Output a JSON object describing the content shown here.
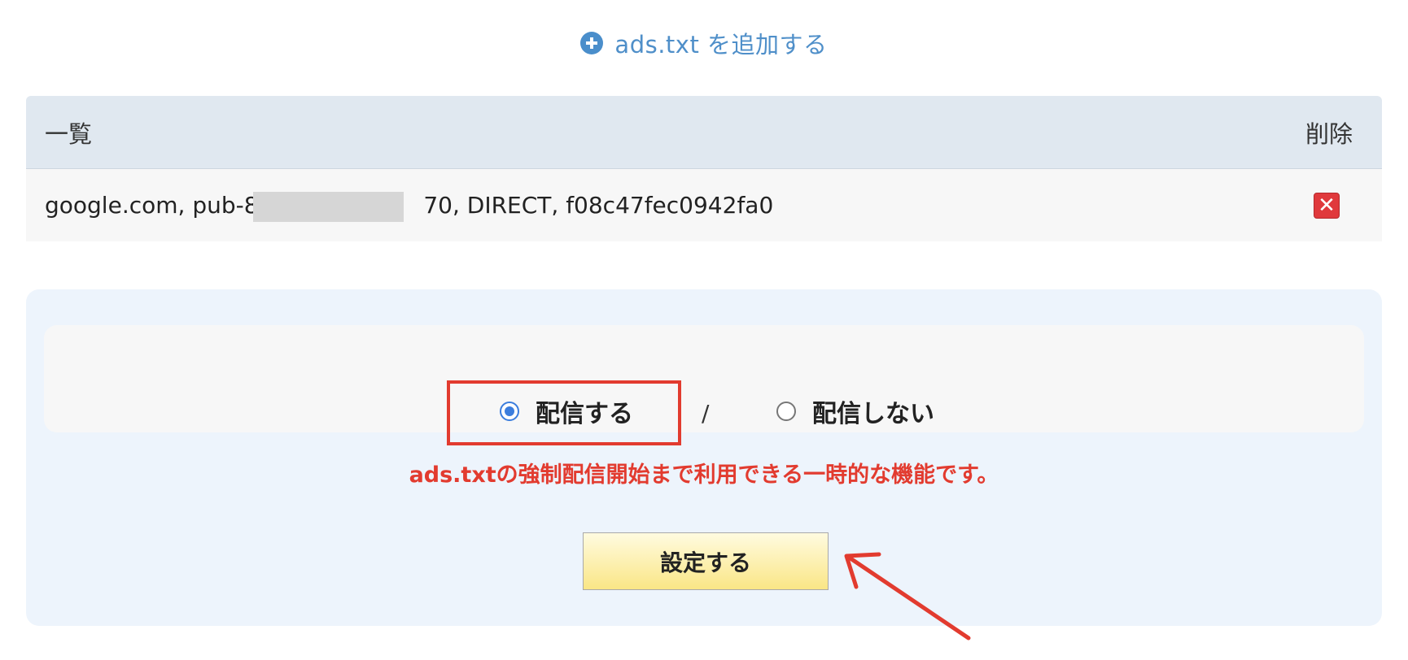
{
  "add_link": {
    "icon": "plus-circle-icon",
    "label": "ads.txt を追加する",
    "color": "#4f8fc9"
  },
  "list": {
    "header_label": "一覧",
    "delete_header": "削除",
    "rows": [
      {
        "entry_prefix": "google.com, pub-87",
        "entry_suffix": "70, DIRECT, f08c47fec0942fa0",
        "delete_icon": "close-icon"
      }
    ]
  },
  "settings": {
    "option_deliver": "配信する",
    "separator": "/",
    "option_no_deliver": "配信しない",
    "selected": "配信する",
    "notice": "ads.txtの強制配信開始まで利用できる一時的な機能です。",
    "submit_label": "設定する"
  },
  "colors": {
    "accent_red": "#e23b2f",
    "radio_blue": "#3b7ddd",
    "panel_bg": "#edf4fc",
    "header_bg": "#e0e8f0",
    "button_yellow": "#fae686"
  }
}
